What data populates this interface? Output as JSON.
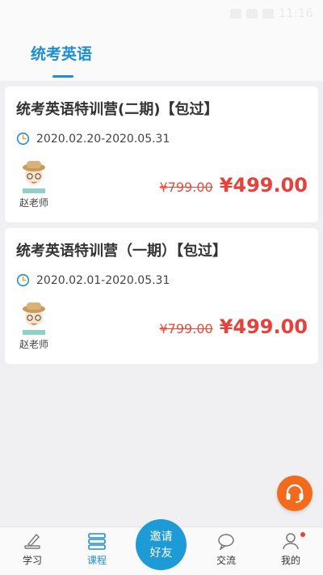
{
  "status_bar": {
    "time": "11:16"
  },
  "header": {
    "tab_label": "统考英语"
  },
  "courses": [
    {
      "title": "统考英语特训营(二期)【包过】",
      "date_range": "2020.02.20-2020.05.31",
      "teacher": "赵老师",
      "old_price": "¥799.00",
      "new_price": "¥499.00"
    },
    {
      "title": "统考英语特训营（一期）【包过】",
      "date_range": "2020.02.01-2020.05.31",
      "teacher": "赵老师",
      "old_price": "¥799.00",
      "new_price": "¥499.00"
    }
  ],
  "bottom_nav": {
    "learn": "学习",
    "course": "课程",
    "invite_line1": "邀请",
    "invite_line2": "好友",
    "chat": "交流",
    "mine": "我的"
  },
  "colors": {
    "accent": "#1e8ed2",
    "price": "#e8403a",
    "support": "#f26a1b"
  }
}
